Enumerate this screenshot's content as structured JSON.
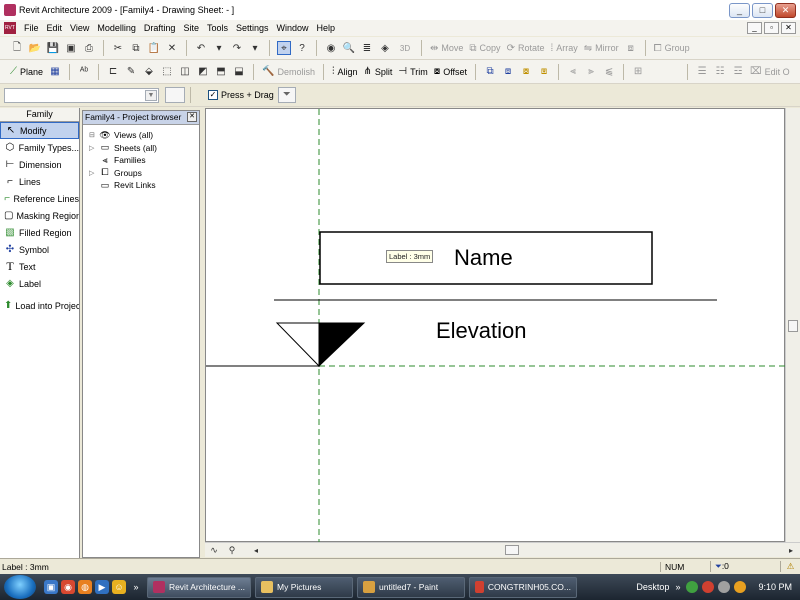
{
  "window": {
    "title": "Revit Architecture 2009 - [Family4 - Drawing Sheet: - ]",
    "controls": [
      "_",
      "□",
      "✕"
    ]
  },
  "menu": {
    "items": [
      "File",
      "Edit",
      "View",
      "Modelling",
      "Drafting",
      "Site",
      "Tools",
      "Settings",
      "Window",
      "Help"
    ]
  },
  "toolbar1": {
    "move": "Move",
    "copy": "Copy",
    "rotate": "Rotate",
    "array": "Array",
    "mirror": "Mirror",
    "group": "Group"
  },
  "toolbar2": {
    "plane": "Plane",
    "demolish": "Demolish",
    "align": "Align",
    "split": "Split",
    "trim": "Trim",
    "offset": "Offset",
    "edit_overflow": "Edit O"
  },
  "options_bar": {
    "type_selector_value": "",
    "press_drag_label": "Press + Drag",
    "press_drag_checked": true
  },
  "family_panel": {
    "header": "Family",
    "items": [
      {
        "label": "Modify",
        "icon": "cursor-icon",
        "selected": true
      },
      {
        "label": "Family Types...",
        "icon": "family-types-icon",
        "selected": false
      },
      {
        "label": "Dimension",
        "icon": "dimension-icon",
        "selected": false
      },
      {
        "label": "Lines",
        "icon": "lines-icon",
        "selected": false
      },
      {
        "label": "Reference Lines",
        "icon": "reference-lines-icon",
        "selected": false
      },
      {
        "label": "Masking Region",
        "icon": "masking-region-icon",
        "selected": false
      },
      {
        "label": "Filled Region",
        "icon": "filled-region-icon",
        "selected": false
      },
      {
        "label": "Symbol",
        "icon": "symbol-icon",
        "selected": false
      },
      {
        "label": "Text",
        "icon": "text-icon",
        "selected": false
      },
      {
        "label": "Label",
        "icon": "label-icon",
        "selected": false
      },
      {
        "label": "Load into Project",
        "icon": "load-icon",
        "selected": false
      }
    ]
  },
  "project_browser": {
    "title": "Family4 - Project browser",
    "items": [
      {
        "label": "Views (all)",
        "icon": "eye-icon"
      },
      {
        "label": "Sheets (all)",
        "icon": "sheet-icon"
      },
      {
        "label": "Families",
        "icon": "families-icon"
      },
      {
        "label": "Groups",
        "icon": "groups-icon"
      },
      {
        "label": "Revit Links",
        "icon": "links-icon"
      }
    ]
  },
  "drawing": {
    "name_text": "Name",
    "elevation_text": "Elevation",
    "label_tooltip": "Label : 3mm"
  },
  "status": {
    "text": "Label : 3mm",
    "num": "NUM",
    "filter": ":0"
  },
  "taskbar": {
    "tasks": [
      {
        "label": "Revit Architecture ...",
        "active": true,
        "color": "#b03060"
      },
      {
        "label": "My Pictures",
        "active": false,
        "color": "#e8c060"
      },
      {
        "label": "untitled7 - Paint",
        "active": false,
        "color": "#d8a040"
      },
      {
        "label": "CONGTRINH05.CO...",
        "active": false,
        "color": "#d04030"
      }
    ],
    "desktop_label": "Desktop",
    "clock": "9:10 PM"
  },
  "colors": {
    "selection": "#c1d2ee",
    "reference_line": "#2e8b2e"
  }
}
